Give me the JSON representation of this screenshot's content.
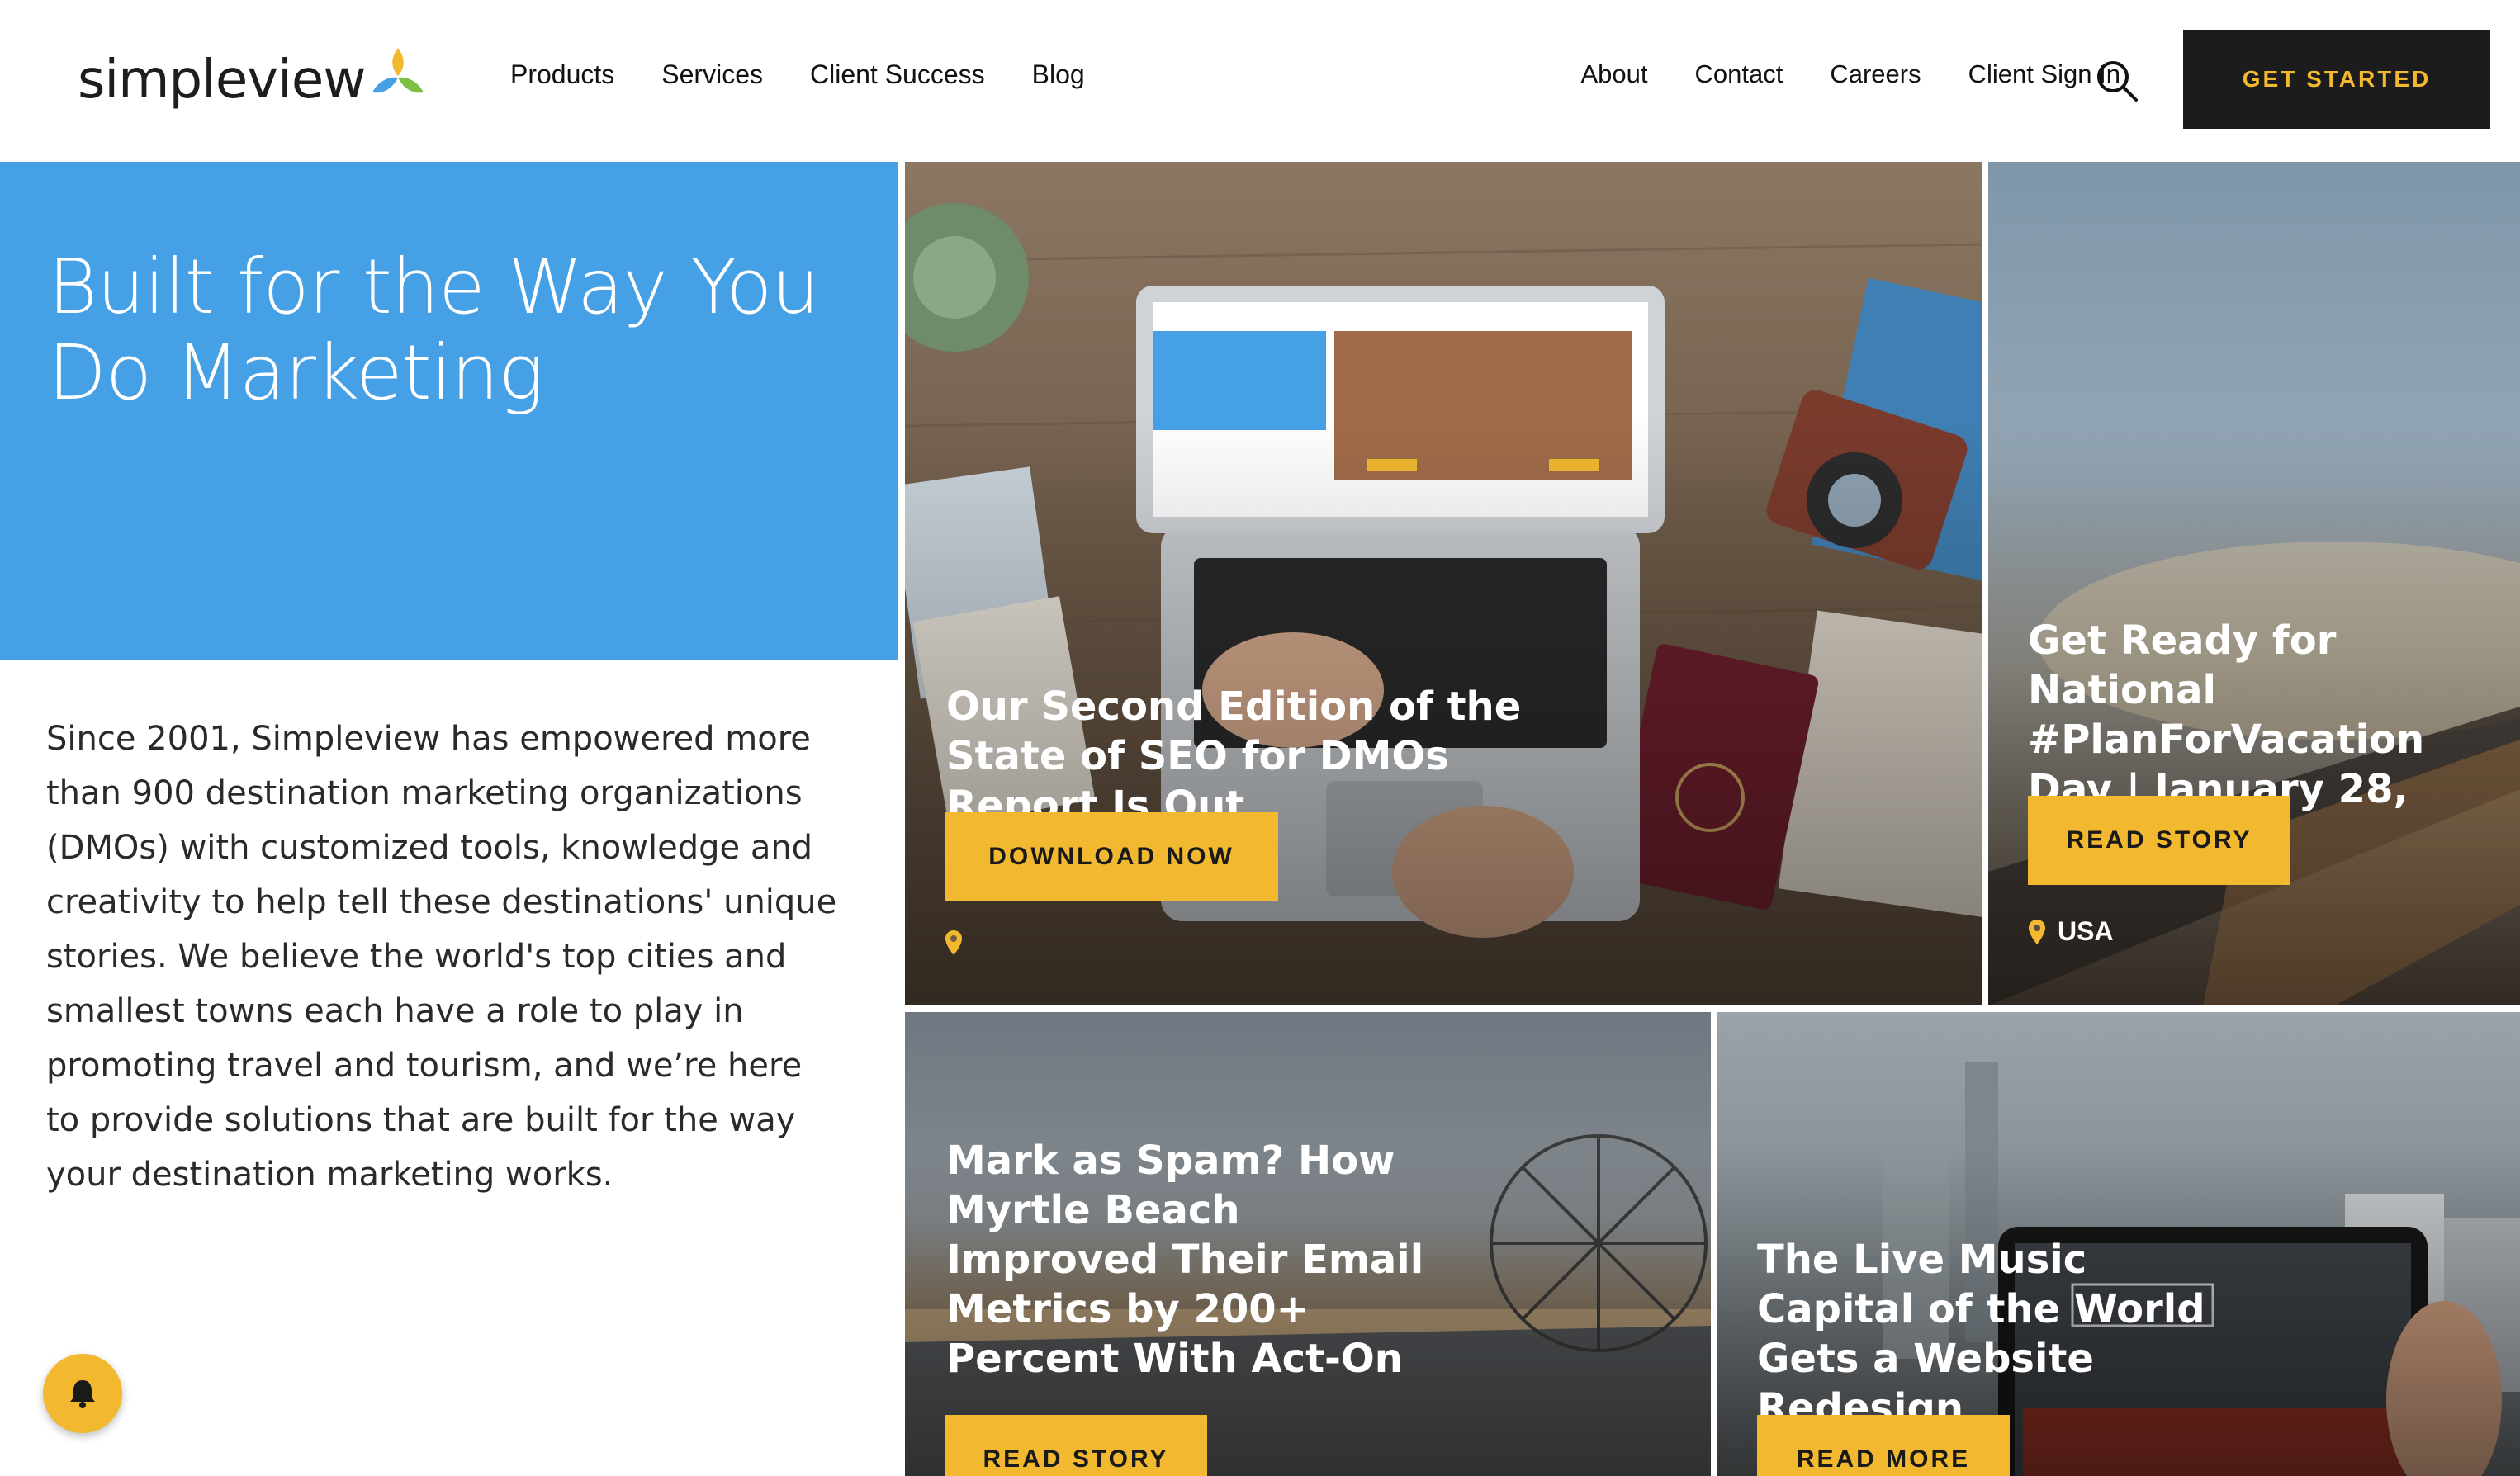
{
  "header": {
    "logo_text": "simpleview",
    "nav_left": [
      "Products",
      "Services",
      "Client Success",
      "Blog"
    ],
    "nav_right": [
      "About",
      "Contact",
      "Careers",
      "Client Sign In"
    ],
    "cta_label": "GET STARTED",
    "icons": {
      "search": "search-icon"
    }
  },
  "hero": {
    "title": "Built for the Way You Do Marketing",
    "intro": "Since 2001, Simpleview has empowered more than 900 destination marketing organizations (DMOs) with customized tools, knowledge and creativity to help tell these destinations' unique stories. We believe the world's top cities and smallest towns each have a role to play in promoting travel and tourism, and we’re here to provide solutions that are built for the way your destination marketing works."
  },
  "tiles": [
    {
      "title": "Our Second Edition of the State of SEO for DMOs Report Is Out",
      "button": "DOWNLOAD NOW",
      "location": ""
    },
    {
      "title": "Get Ready for National #PlanForVacation Day | January 28, 2020",
      "button": "READ STORY",
      "location": "USA"
    },
    {
      "title": "Mark as Spam? How Myrtle Beach Improved Their Email Metrics by 200+ Percent With Act-On",
      "button": "READ STORY",
      "location": ""
    },
    {
      "title": "The Live Music Capital of the World Gets a Website Redesign",
      "button": "READ MORE",
      "location": ""
    }
  ],
  "colors": {
    "accent_yellow": "#f2b930",
    "hero_blue": "#45a0e6",
    "cta_black": "#1c1c1c"
  },
  "notification": {
    "icon": "bell-icon"
  }
}
